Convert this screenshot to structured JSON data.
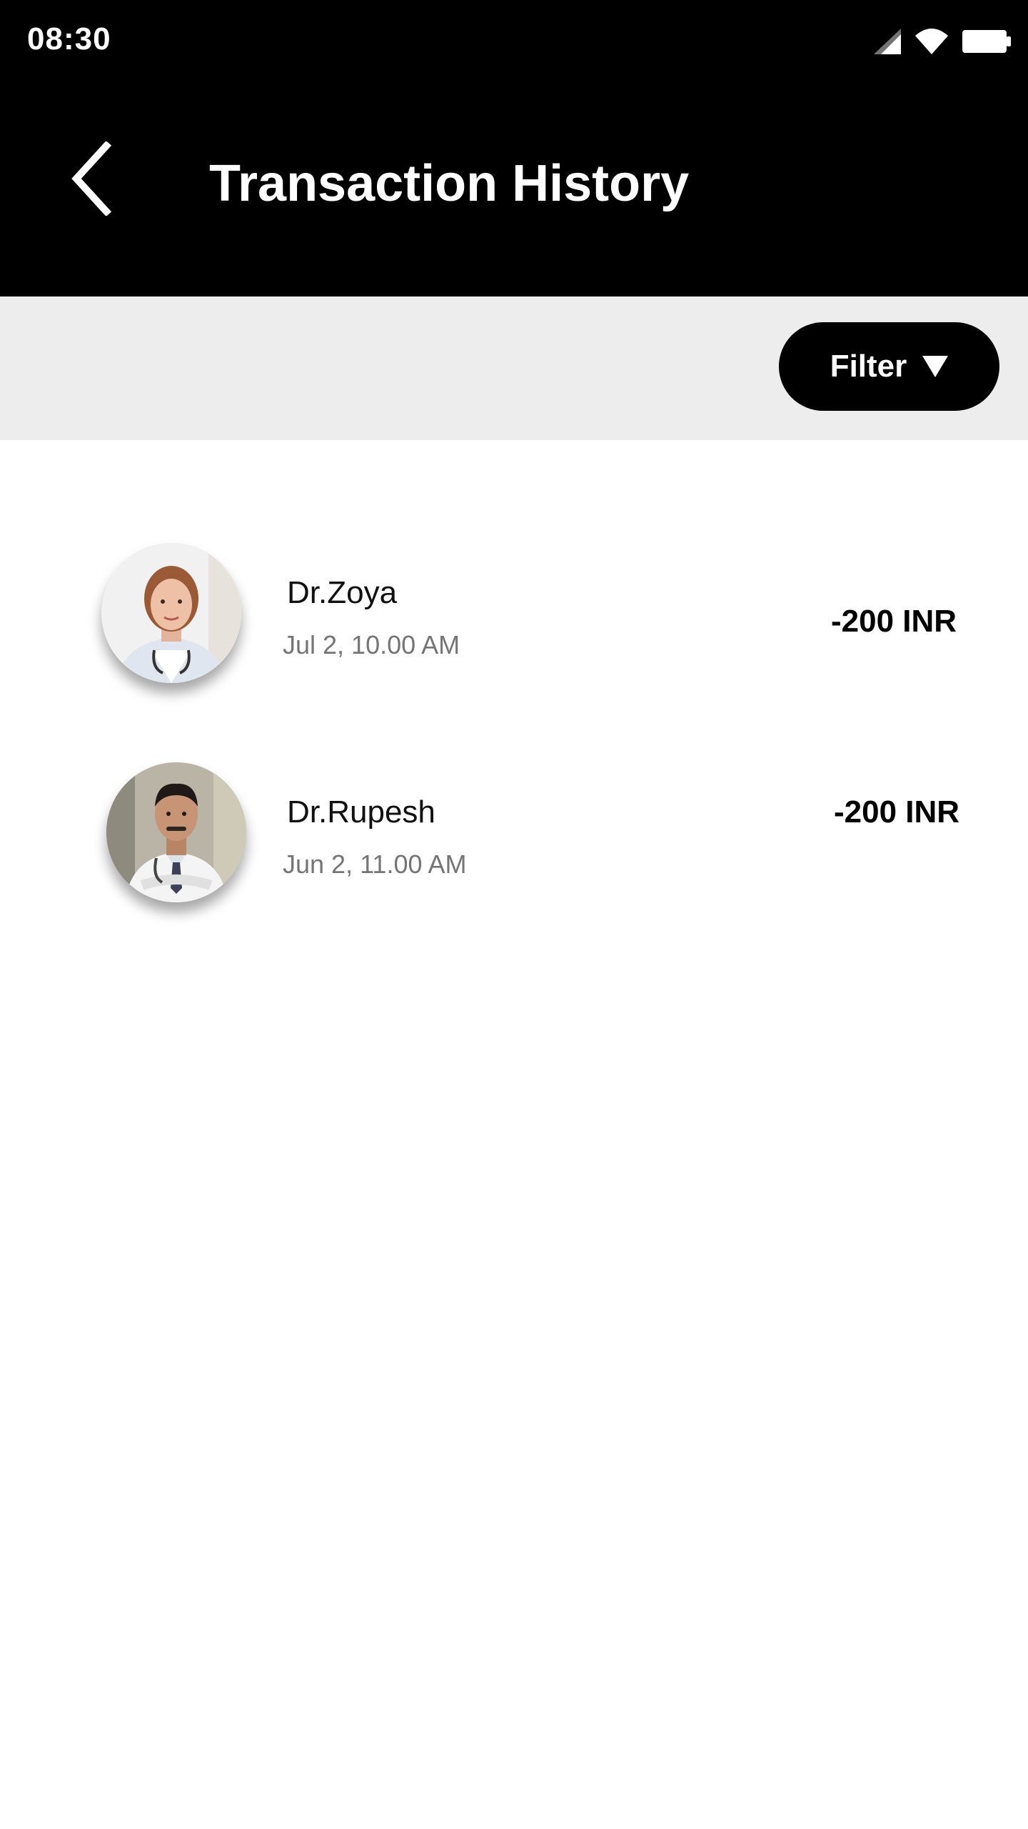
{
  "status_bar": {
    "time": "08:30",
    "icons": [
      "signal-icon",
      "wifi-icon",
      "battery-icon"
    ]
  },
  "header": {
    "title": "Transaction History",
    "back_icon": "back-arrow-icon"
  },
  "filter": {
    "label": "Filter",
    "icon": "caret-down-icon"
  },
  "transactions": [
    {
      "name": "Dr.Zoya",
      "datetime": "Jul 2, 10.00 AM",
      "amount": "-200 INR",
      "avatar": "doctor-avatar-female"
    },
    {
      "name": "Dr.Rupesh",
      "datetime": "Jun 2, 11.00 AM",
      "amount": "-200 INR",
      "avatar": "doctor-avatar-male"
    }
  ],
  "colors": {
    "appbar": "#000000",
    "filter_bar": "#ededed",
    "filter_button": "#000000",
    "secondary_text": "#757575"
  }
}
